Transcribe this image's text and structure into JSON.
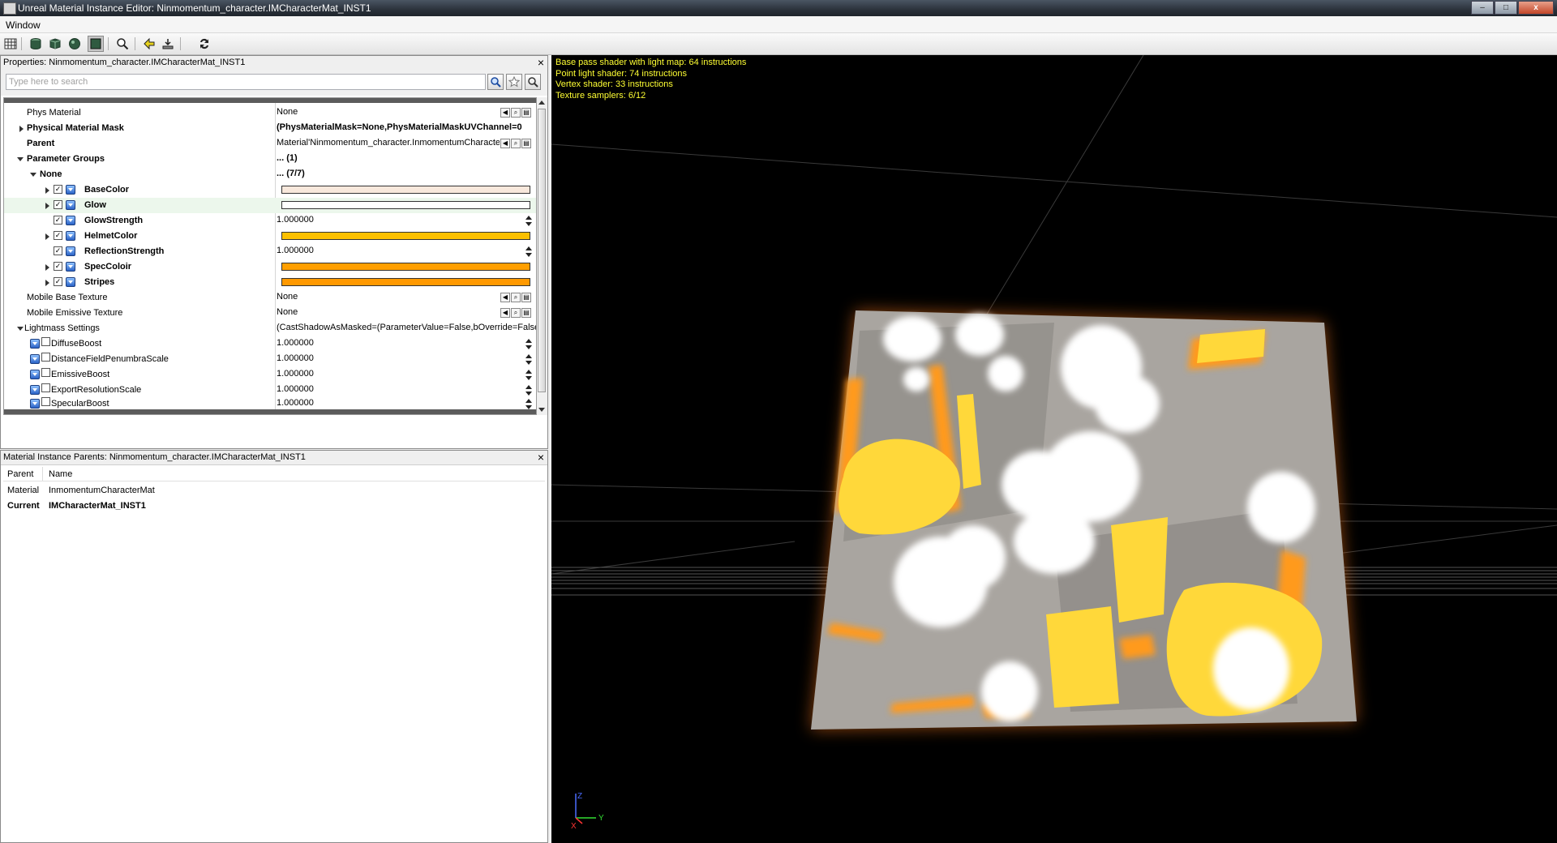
{
  "window": {
    "title": "Unreal Material Instance Editor: Ninmomentum_character.IMCharacterMat_INST1",
    "minimize": "–",
    "maximize": "□",
    "close": "x"
  },
  "menu": {
    "items": [
      "Window"
    ]
  },
  "toolbar": {
    "buttons": [
      {
        "icon": "grid-icon"
      },
      {
        "icon": "cylinder-icon"
      },
      {
        "icon": "cube-icon"
      },
      {
        "icon": "sphere-icon"
      },
      {
        "icon": "plane-icon",
        "pressed": true
      },
      {
        "icon": "magnify-icon"
      },
      {
        "icon": "back-arrow-icon"
      },
      {
        "icon": "content-browser-icon"
      },
      {
        "icon": "sync-icon"
      }
    ]
  },
  "properties": {
    "title": "Properties: Ninmomentum_character.IMCharacterMat_INST1",
    "close": "×",
    "search_placeholder": "Type here to search",
    "rows": [
      {
        "name": "Phys Material",
        "value": "None"
      },
      {
        "name": "Physical Material Mask",
        "value": "(PhysMaterialMask=None,PhysMaterialMaskUVChannel=0"
      },
      {
        "name": "Parent",
        "value": "Material'Ninmomentum_character.InmomentumCharacterMat'"
      },
      {
        "name": "Parameter Groups",
        "value": "... (1)"
      },
      {
        "name": "None",
        "value": "... (7/7)"
      },
      {
        "name": "BaseColor",
        "color": "#f8e8dc"
      },
      {
        "name": "Glow",
        "color": "#ffffff"
      },
      {
        "name": "GlowStrength",
        "value": "1.000000"
      },
      {
        "name": "HelmetColor",
        "color": "#fbc000"
      },
      {
        "name": "ReflectionStrength",
        "value": "1.000000"
      },
      {
        "name": "SpecColoir",
        "color": "#ff9f00"
      },
      {
        "name": "Stripes",
        "color": "#ff9900"
      },
      {
        "name": "Mobile Base Texture",
        "value": "None"
      },
      {
        "name": "Mobile Emissive Texture",
        "value": "None"
      },
      {
        "name": "Lightmass Settings",
        "value": "(CastShadowAsMasked=(ParameterValue=False,bOverride=False)"
      },
      {
        "name": "DiffuseBoost",
        "value": "1.000000"
      },
      {
        "name": "DistanceFieldPenumbraScale",
        "value": "1.000000"
      },
      {
        "name": "EmissiveBoost",
        "value": "1.000000"
      },
      {
        "name": "ExportResolutionScale",
        "value": "1.000000"
      },
      {
        "name": "SpecularBoost",
        "value": "1.000000"
      }
    ]
  },
  "parents": {
    "title": "Material Instance Parents: Ninmomentum_character.IMCharacterMat_INST1",
    "close": "×",
    "columns": [
      "Parent",
      "Name"
    ],
    "rows": [
      {
        "parent": "Material",
        "name": "InmomentumCharacterMat"
      },
      {
        "parent": "Current",
        "name": "IMCharacterMat_INST1"
      }
    ]
  },
  "viewport": {
    "stats": [
      "Base pass shader with light map: 64 instructions",
      "Point light shader: 74 instructions",
      "Vertex shader: 33 instructions",
      "Texture samplers: 6/12"
    ],
    "axis_labels": [
      "Z",
      "Y",
      "X"
    ],
    "colors": {
      "stats": "#ffff33",
      "glow": "#ff7a1a",
      "background": "#000000"
    }
  }
}
